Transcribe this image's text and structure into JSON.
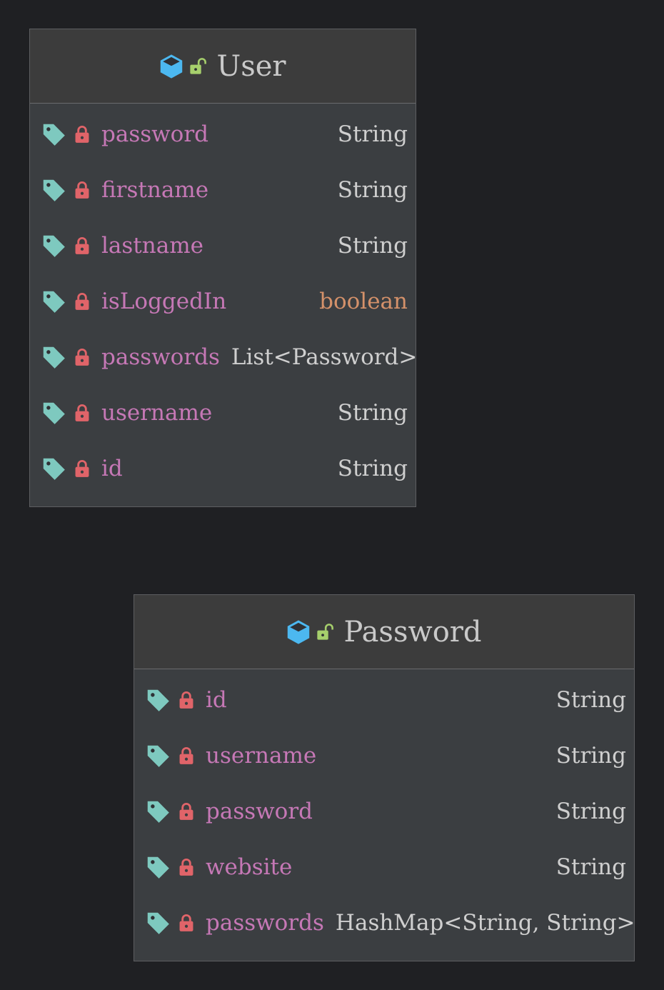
{
  "classes": [
    {
      "name": "User",
      "kind_icon": "class-cube-icon",
      "access_icon": "unlocked-public-icon",
      "fields": [
        {
          "name": "password",
          "type": "String",
          "primitive": false
        },
        {
          "name": "firstname",
          "type": "String",
          "primitive": false
        },
        {
          "name": "lastname",
          "type": "String",
          "primitive": false
        },
        {
          "name": "isLoggedIn",
          "type": "boolean",
          "primitive": true
        },
        {
          "name": "passwords",
          "type": "List<Password>",
          "primitive": false
        },
        {
          "name": "username",
          "type": "String",
          "primitive": false
        },
        {
          "name": "id",
          "type": "String",
          "primitive": false
        }
      ]
    },
    {
      "name": "Password",
      "kind_icon": "class-cube-icon",
      "access_icon": "unlocked-public-icon",
      "fields": [
        {
          "name": "id",
          "type": "String",
          "primitive": false
        },
        {
          "name": "username",
          "type": "String",
          "primitive": false
        },
        {
          "name": "password",
          "type": "String",
          "primitive": false
        },
        {
          "name": "website",
          "type": "String",
          "primitive": false
        },
        {
          "name": "passwords",
          "type": "HashMap<String,  String>",
          "primitive": false
        }
      ]
    }
  ],
  "field_icons": {
    "tag": "field-tag-icon",
    "lock": "private-lock-icon"
  },
  "colors": {
    "background": "#1f2023",
    "box_fill": "#3b3e41",
    "header_fill": "#3c3c3c",
    "border": "#5d5e61",
    "title": "#c9c9c9",
    "field_name": "#c678b6",
    "field_type": "#cfcfcf",
    "primitive_type": "#d4916a",
    "cube_icon": "#4cb8f0",
    "unlocked_icon": "#a6cf6c",
    "tag_icon": "#7ec9bf",
    "lock_icon": "#e06469"
  }
}
